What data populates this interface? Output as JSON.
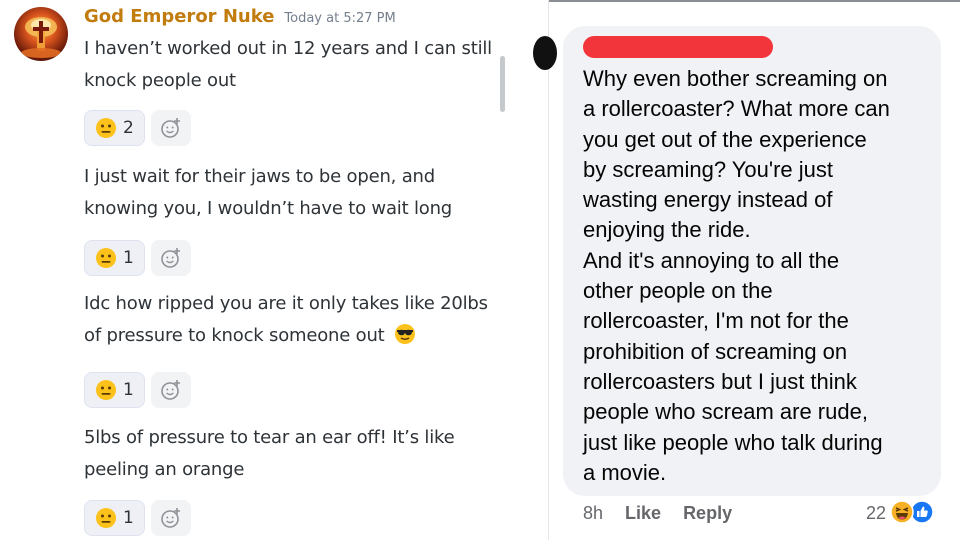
{
  "discord": {
    "username": "God Emperor Nuke",
    "timestamp": "Today at 5:27 PM",
    "messages": [
      {
        "text": "I haven’t worked out in 12 years and I can still knock people out",
        "reaction": {
          "emoji": "neutral-face",
          "count": "2"
        }
      },
      {
        "text": "I just wait for their jaws to be open, and knowing you, I wouldn’t have to wait long",
        "reaction": {
          "emoji": "neutral-face",
          "count": "1"
        }
      },
      {
        "text": "Idc how ripped you are it only takes like 20lbs of pressure to knock someone out",
        "trailing_emoji": "sunglasses-face",
        "reaction": {
          "emoji": "neutral-face",
          "count": "1"
        }
      },
      {
        "text": "5lbs of pressure to tear an ear off! It’s like peeling an orange",
        "reaction": {
          "emoji": "neutral-face",
          "count": "1"
        }
      }
    ],
    "colors": {
      "username": "#c27c0e",
      "timestamp": "#747f8d",
      "reaction_bg": "#eef0f6"
    }
  },
  "facebook": {
    "comment_lines": [
      "Why even bother screaming on",
      "a rollercoaster? What more can",
      "you get out of the experience",
      "by screaming? You're just",
      "wasting energy instead of",
      "enjoying the ride.",
      "And it's annoying to all the",
      "other people on the",
      "rollercoaster, I'm not for the",
      "prohibition of screaming on",
      "rollercoasters but I just think",
      "people who scream are rude,",
      "just like people who talk during",
      "a movie."
    ],
    "time": "8h",
    "like_label": "Like",
    "reply_label": "Reply",
    "reaction_count": "22",
    "reaction_icons": [
      "haha-icon",
      "like-icon"
    ],
    "colors": {
      "bubble": "#f0f2f5",
      "redaction": "#f2353b",
      "like_blue": "#1877f2"
    }
  }
}
